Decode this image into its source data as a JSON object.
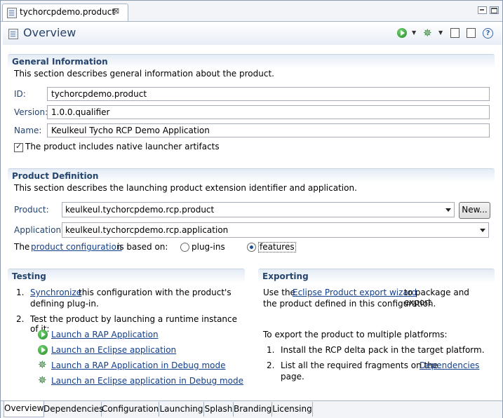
{
  "editor_tab": {
    "title": "tychorcpdemo.product",
    "close_glyph": "⊠"
  },
  "header": {
    "title": "Overview"
  },
  "icons": {
    "file": "product-file-icon",
    "run": "run-launch-icon",
    "debug": "debug-bug-icon",
    "export": "export-icon",
    "validate": "validate-icon",
    "help": "help-icon",
    "help_glyph": "?",
    "debug_glyph": "✵",
    "dropdown_glyph": "▼"
  },
  "general": {
    "title": "General Information",
    "description": "This section describes general information about the product.",
    "id_label": "ID:",
    "id_value": "tychorcpdemo.product",
    "version_label": "Version:",
    "version_value": "1.0.0.qualifier",
    "name_label": "Name:",
    "name_value": "Keulkeul Tycho RCP Demo Application",
    "native_launcher_label": "The product includes native launcher artifacts",
    "native_launcher_checked": true
  },
  "definition": {
    "title": "Product Definition",
    "description": "This section describes the launching product extension identifier and application.",
    "product_label": "Product:",
    "product_value": "keulkeul.tychorcpdemo.rcp.product",
    "new_button": "New...",
    "application_label": "Application:",
    "application_value": "keulkeul.tychorcpdemo.rcp.application",
    "config_prefix": "The",
    "config_link": "product configuration",
    "config_suffix": "is based on:",
    "option_plugins": "plug-ins",
    "option_features": "features",
    "selected": "features"
  },
  "testing": {
    "title": "Testing",
    "step1_num": "1.",
    "step1_link": "Synchronize",
    "step1_text": "this configuration with the product's",
    "step1_text2": "defining plug-in.",
    "step2_num": "2.",
    "step2_text": "Test the product by launching a runtime instance of it:",
    "launch_rap": "Launch a RAP Application",
    "launch_eclipse": "Launch an Eclipse application",
    "debug_rap": "Launch a RAP Application in Debug mode",
    "debug_eclipse": "Launch an Eclipse application in Debug mode"
  },
  "exporting": {
    "title": "Exporting",
    "text_prefix": "Use the",
    "wizard_link": "Eclipse Product export wizard",
    "text_suffix": "to package and export",
    "text_line2": "the product defined in this configuration.",
    "multi_intro": "To export the product to multiple platforms:",
    "step1_num": "1.",
    "step1_text": "Install the RCP delta pack in the target platform.",
    "step2_num": "2.",
    "step2_text": "List all the required fragments on the",
    "step2_link": "Dependencies",
    "step2_end": "page."
  },
  "bottom_tabs": [
    "Overview",
    "Dependencies",
    "Configuration",
    "Launching",
    "Splash",
    "Branding",
    "Licensing"
  ],
  "active_bottom_tab": "Overview"
}
